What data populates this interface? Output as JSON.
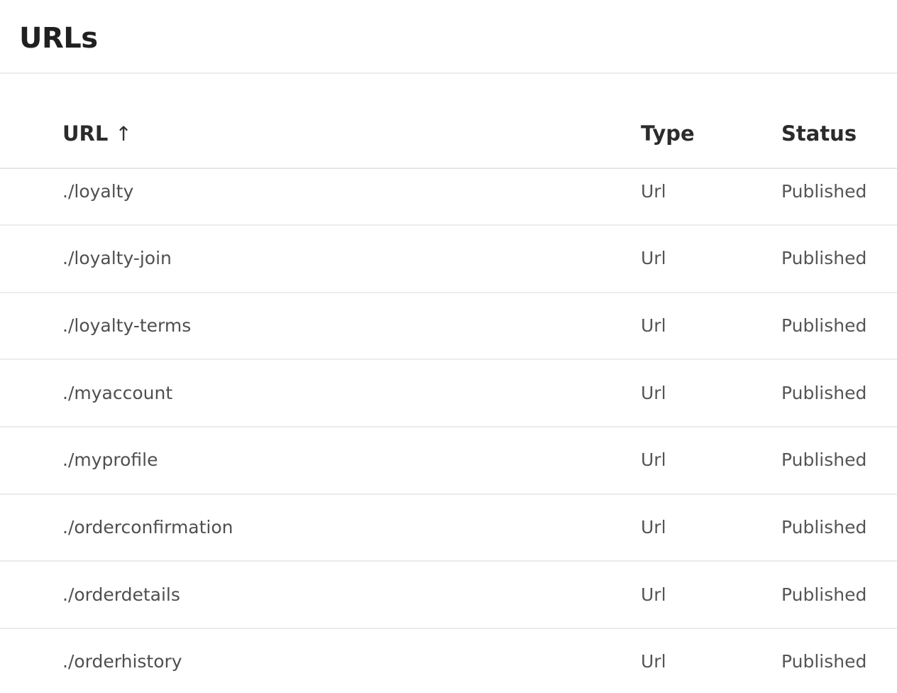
{
  "page": {
    "title": "URLs"
  },
  "table": {
    "columns": {
      "url": "URL",
      "url_sort_icon": "↑",
      "type": "Type",
      "status": "Status"
    },
    "rows": [
      {
        "url": "./loyalty",
        "type": "Url",
        "status": "Published"
      },
      {
        "url": "./loyalty-join",
        "type": "Url",
        "status": "Published"
      },
      {
        "url": "./loyalty-terms",
        "type": "Url",
        "status": "Published"
      },
      {
        "url": "./myaccount",
        "type": "Url",
        "status": "Published"
      },
      {
        "url": "./myprofile",
        "type": "Url",
        "status": "Published"
      },
      {
        "url": "./orderconfirmation",
        "type": "Url",
        "status": "Published"
      },
      {
        "url": "./orderdetails",
        "type": "Url",
        "status": "Published"
      },
      {
        "url": "./orderhistory",
        "type": "Url",
        "status": "Published"
      }
    ]
  },
  "colors": {
    "title": "#202020",
    "header_text": "#2b2b2b",
    "cell_text": "#555555",
    "divider": "#ececec",
    "background": "#ffffff"
  }
}
